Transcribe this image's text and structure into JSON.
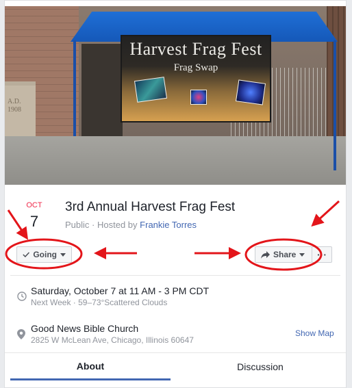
{
  "cover": {
    "banner_title": "Harvest Frag Fest",
    "banner_subtitle": "Frag Swap",
    "cornerstone": "A.D.\n1908"
  },
  "event": {
    "month": "OCT",
    "day": "7",
    "title": "3rd Annual Harvest Frag Fest",
    "privacy": "Public",
    "hosted_prefix": "Hosted by",
    "host": "Frankie Torres"
  },
  "actions": {
    "going_label": "Going",
    "share_label": "Share"
  },
  "details": {
    "datetime": "Saturday, October 7 at 11 AM - 3 PM CDT",
    "datetime_sub": "Next Week · 59–73°Scattered Clouds",
    "location_name": "Good News Bible Church",
    "location_address": "2825 W McLean Ave, Chicago, Illinois 60647",
    "show_map": "Show Map"
  },
  "tabs": [
    {
      "label": "About",
      "active": true
    },
    {
      "label": "Discussion",
      "active": false
    }
  ],
  "colors": {
    "accent": "#4267b2",
    "date_month": "#f02849",
    "annotation": "#e3151a"
  },
  "icons": {
    "going": "check-icon",
    "share": "share-arrow-icon",
    "time": "clock-icon",
    "place": "map-pin-icon"
  }
}
